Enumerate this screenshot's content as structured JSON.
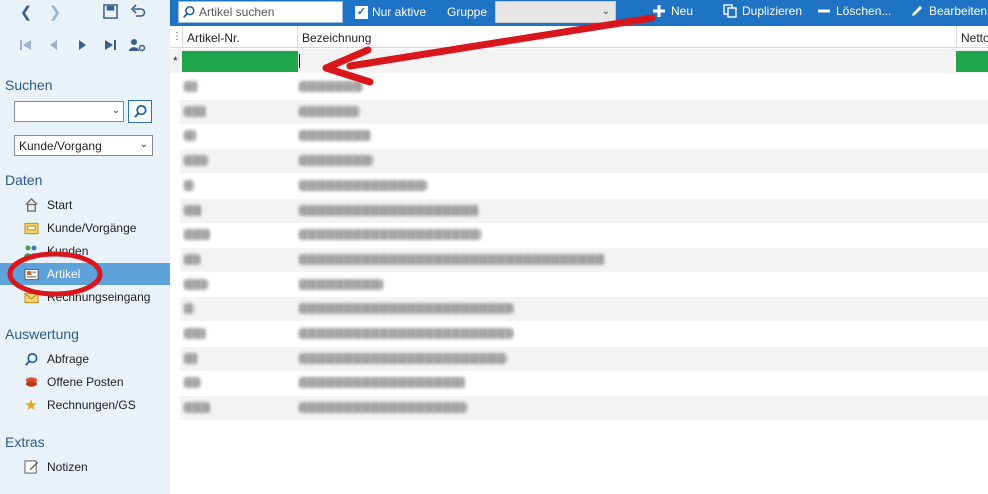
{
  "sidebar": {
    "search_title": "Suchen",
    "search_value": "",
    "scope_select": "Kunde/Vorgang",
    "sections": {
      "daten": "Daten",
      "auswertung": "Auswertung",
      "extras": "Extras"
    },
    "daten_items": [
      {
        "label": "Start",
        "icon": "home-icon"
      },
      {
        "label": "Kunde/Vorgänge",
        "icon": "folder-icon"
      },
      {
        "label": "Kunden",
        "icon": "people-icon"
      },
      {
        "label": "Artikel",
        "icon": "article-icon",
        "active": true
      },
      {
        "label": "Rechnungseingang",
        "icon": "invoice-icon"
      }
    ],
    "auswertung_items": [
      {
        "label": "Abfrage",
        "icon": "magnifier-icon"
      },
      {
        "label": "Offene Posten",
        "icon": "coins-icon"
      },
      {
        "label": "Rechnungen/GS",
        "icon": "star-icon"
      }
    ],
    "extras_items": [
      {
        "label": "Notizen",
        "icon": "note-icon"
      }
    ]
  },
  "toolbar": {
    "search_placeholder": "Artikel suchen",
    "only_active_label": "Nur aktive",
    "only_active_checked": true,
    "group_label": "Gruppe",
    "group_value": "",
    "new_label": "Neu",
    "duplicate_label": "Duplizieren",
    "delete_label": "Löschen...",
    "edit_label": "Bearbeiten"
  },
  "grid": {
    "columns": [
      "Artikel-Nr.",
      "Bezeichnung",
      "Netto"
    ],
    "new_row_marker": "*",
    "rows_obscured": 14
  },
  "colors": {
    "toolbar_bg": "#1f73c4",
    "sidebar_bg": "#e9f1f9",
    "active_nav": "#5ea2dc",
    "new_row_highlight": "#1fa64a",
    "annotation_red": "#d8161c"
  }
}
